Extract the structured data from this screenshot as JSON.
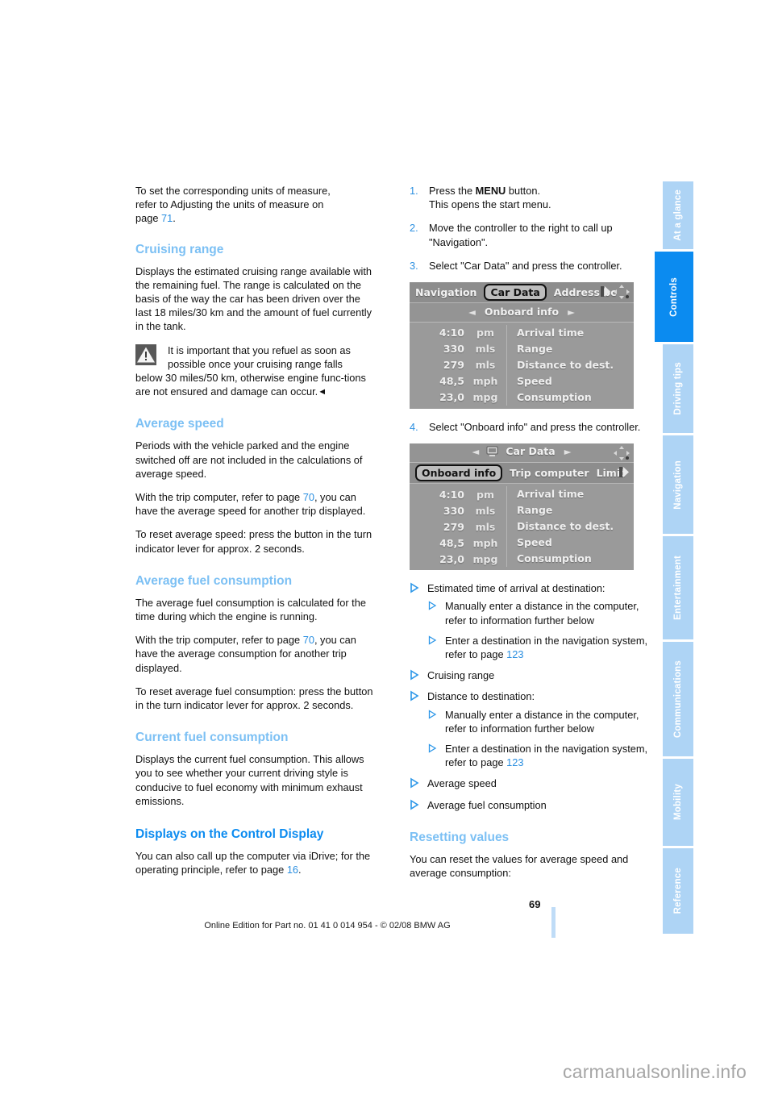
{
  "document": {
    "page_number": "69",
    "footer_note": "Online Edition for Part no. 01 41 0 014 954  - © 02/08 BMW AG",
    "watermark": "carmanualsonline.info",
    "accent_light": "#7cc0f4",
    "accent_strong": "#0b8bf0",
    "link_color": "#2b8fe0"
  },
  "sidebar": {
    "items": [
      {
        "label": "At a glance",
        "active": false
      },
      {
        "label": "Controls",
        "active": true
      },
      {
        "label": "Driving tips",
        "active": false
      },
      {
        "label": "Navigation",
        "active": false
      },
      {
        "label": "Entertainment",
        "active": false
      },
      {
        "label": "Communications",
        "active": false
      },
      {
        "label": "Mobility",
        "active": false
      },
      {
        "label": "Reference",
        "active": false
      }
    ]
  },
  "left_column": {
    "intro": {
      "line1": "To set the corresponding units of measure,",
      "line2": "refer to Adjusting the units of measure on",
      "line3_prefix": "page ",
      "line3_page": "71",
      "line3_suffix": "."
    },
    "cruising_range": {
      "heading": "Cruising range",
      "body": "Displays the estimated cruising range available with the remaining fuel. The range is calculated on the basis of the way the car has been driven over the last 18 miles/30 km and the amount of fuel currently in the tank.",
      "warning_line1": "It is important that you refuel as soon as",
      "warning_line2": "possible once your cruising range falls",
      "warning_rest": "below 30 miles/50 km, otherwise engine func-tions are not ensured and damage can occur.",
      "warning_endmark": "◄"
    },
    "average_speed": {
      "heading": "Average speed",
      "p1": "Periods with the vehicle parked and the engine switched off are not included in the calculations of average speed.",
      "p2_pre": "With the trip computer, refer to page ",
      "p2_page": "70",
      "p2_post": ", you can have the average speed for another trip displayed.",
      "p3": "To reset average speed: press the button in the turn indicator lever for approx. 2 seconds."
    },
    "average_fuel_consumption": {
      "heading": "Average fuel consumption",
      "p1": "The average fuel consumption is calculated for the time during which the engine is running.",
      "p2_pre": "With the trip computer, refer to page ",
      "p2_page": "70",
      "p2_post": ", you can have the average consumption for another trip displayed.",
      "p3": "To reset average fuel consumption: press the button in the turn indicator lever for approx. 2 seconds."
    },
    "current_fuel_consumption": {
      "heading": "Current fuel consumption",
      "p1": "Displays the current fuel consumption. This allows you to see whether your current driving style is conducive to fuel economy with minimum exhaust emissions."
    },
    "displays_on_control_display": {
      "heading": "Displays on the Control Display",
      "p1_pre": "You can also call up the computer via iDrive; for the operating principle, refer to page ",
      "p1_page": "16",
      "p1_post": "."
    }
  },
  "right_column": {
    "steps": [
      {
        "num": "1.",
        "text_before_bold": "Press the ",
        "bold": "MENU",
        "text_after_bold": " button.",
        "line2": "This opens the start menu."
      },
      {
        "num": "2.",
        "text_before_bold": "Move the controller to the right to call up",
        "bold": "",
        "text_after_bold": "",
        "line2": "\"Navigation\"."
      },
      {
        "num": "3.",
        "text_before_bold": "Select \"Car Data\" and press the controller.",
        "bold": "",
        "text_after_bold": "",
        "line2": ""
      }
    ],
    "step4": {
      "num": "4.",
      "text": "Select \"Onboard info\" and press the controller."
    },
    "bullets": [
      {
        "label": "Estimated time of arrival at destination:",
        "sub": [
          {
            "text": "Manually enter a distance in the computer, refer to information further below",
            "page": ""
          },
          {
            "text_pre": "Enter a destination in the navigation system, refer to page ",
            "page": "123"
          }
        ]
      },
      {
        "label": "Cruising range",
        "sub": []
      },
      {
        "label": "Distance to destination:",
        "sub": [
          {
            "text": "Manually enter a distance in the computer, refer to information further below",
            "page": ""
          },
          {
            "text_pre": "Enter a destination in the navigation system, refer to page ",
            "page": "123"
          }
        ]
      },
      {
        "label": "Average speed",
        "sub": []
      },
      {
        "label": "Average fuel consumption",
        "sub": []
      }
    ],
    "resetting_values": {
      "heading": "Resetting values",
      "p1": "You can reset the values for average speed and average consumption:"
    }
  },
  "screenshot_1": {
    "menu_bar": {
      "item_left": "Navigation",
      "item_selected": "Car Data",
      "item_right": "Address bc"
    },
    "title_row": {
      "prev_arrow": "◄",
      "title": "Onboard info",
      "next_arrow": "►"
    },
    "rows": [
      {
        "value": "4:10",
        "unit": "pm",
        "label": "Arrival time"
      },
      {
        "value": "330",
        "unit": "mls",
        "label": "Range"
      },
      {
        "value": "279",
        "unit": "mls",
        "label": "Distance to dest."
      },
      {
        "value": "48,5",
        "unit": "mph",
        "label": "Speed"
      },
      {
        "value": "23,0",
        "unit": "mpg",
        "label": "Consumption"
      }
    ]
  },
  "screenshot_2": {
    "title_row": {
      "prev_arrow": "◄",
      "title": "Car Data",
      "next_arrow": "►"
    },
    "menu_bar": {
      "item_selected": "Onboard info",
      "item_2": "Trip computer",
      "item_3": "Limit"
    },
    "rows": [
      {
        "value": "4:10",
        "unit": "pm",
        "label": "Arrival time"
      },
      {
        "value": "330",
        "unit": "mls",
        "label": "Range"
      },
      {
        "value": "279",
        "unit": "mls",
        "label": "Distance to dest."
      },
      {
        "value": "48,5",
        "unit": "mph",
        "label": "Speed"
      },
      {
        "value": "23,0",
        "unit": "mpg",
        "label": "Consumption"
      }
    ]
  }
}
